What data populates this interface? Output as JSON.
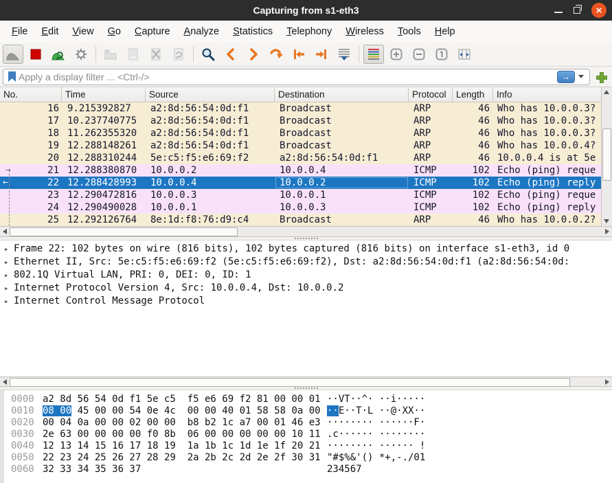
{
  "window": {
    "title": "Capturing from s1-eth3"
  },
  "menu": {
    "items": [
      {
        "label": "File"
      },
      {
        "label": "Edit"
      },
      {
        "label": "View"
      },
      {
        "label": "Go"
      },
      {
        "label": "Capture"
      },
      {
        "label": "Analyze"
      },
      {
        "label": "Statistics"
      },
      {
        "label": "Telephony"
      },
      {
        "label": "Wireless"
      },
      {
        "label": "Tools"
      },
      {
        "label": "Help"
      }
    ]
  },
  "toolbar": {
    "icons": [
      "start-capture",
      "stop-capture",
      "restart-capture",
      "capture-options",
      "open-file",
      "save-file",
      "close-file",
      "reload-file",
      "find-packet",
      "go-back",
      "go-forward",
      "go-to-packet",
      "go-first",
      "go-last",
      "auto-scroll",
      "colorize",
      "zoom-in",
      "zoom-out",
      "zoom-original",
      "resize-columns"
    ]
  },
  "filter": {
    "placeholder": "Apply a display filter ... <Ctrl-/>"
  },
  "colors": {
    "selection": "#1d76c2",
    "arp_row": "#f6edd4",
    "icmp_row": "#f9e2f9",
    "close_button": "#e95420",
    "nav_arrows": "#e87722"
  },
  "packet_list": {
    "columns": [
      "No.",
      "Time",
      "Source",
      "Destination",
      "Protocol",
      "Length",
      "Info"
    ],
    "indicators": {
      "request": "→",
      "response": "←"
    },
    "rows": [
      {
        "no": "16",
        "time": "9.215392827",
        "source": "a2:8d:56:54:0d:f1",
        "destination": "Broadcast",
        "protocol": "ARP",
        "length": "46",
        "info": "Who has 10.0.0.3?"
      },
      {
        "no": "17",
        "time": "10.237740775",
        "source": "a2:8d:56:54:0d:f1",
        "destination": "Broadcast",
        "protocol": "ARP",
        "length": "46",
        "info": "Who has 10.0.0.3?"
      },
      {
        "no": "18",
        "time": "11.262355320",
        "source": "a2:8d:56:54:0d:f1",
        "destination": "Broadcast",
        "protocol": "ARP",
        "length": "46",
        "info": "Who has 10.0.0.3?"
      },
      {
        "no": "19",
        "time": "12.288148261",
        "source": "a2:8d:56:54:0d:f1",
        "destination": "Broadcast",
        "protocol": "ARP",
        "length": "46",
        "info": "Who has 10.0.0.4?"
      },
      {
        "no": "20",
        "time": "12.288310244",
        "source": "5e:c5:f5:e6:69:f2",
        "destination": "a2:8d:56:54:0d:f1",
        "protocol": "ARP",
        "length": "46",
        "info": "10.0.0.4 is at 5e"
      },
      {
        "no": "21",
        "time": "12.288380870",
        "source": "10.0.0.2",
        "destination": "10.0.0.4",
        "protocol": "ICMP",
        "length": "102",
        "info": "Echo (ping) reque"
      },
      {
        "no": "22",
        "time": "12.288428993",
        "source": "10.0.0.4",
        "destination": "10.0.0.2",
        "protocol": "ICMP",
        "length": "102",
        "info": "Echo (ping) reply"
      },
      {
        "no": "23",
        "time": "12.290472816",
        "source": "10.0.0.3",
        "destination": "10.0.0.1",
        "protocol": "ICMP",
        "length": "102",
        "info": "Echo (ping) reque"
      },
      {
        "no": "24",
        "time": "12.290490028",
        "source": "10.0.0.1",
        "destination": "10.0.0.3",
        "protocol": "ICMP",
        "length": "102",
        "info": "Echo (ping) reply"
      },
      {
        "no": "25",
        "time": "12.292126764",
        "source": "8e:1d:f8:76:d9:c4",
        "destination": "Broadcast",
        "protocol": "ARP",
        "length": "46",
        "info": "Who has 10.0.0.2?"
      }
    ]
  },
  "details": {
    "expander_glyph": "▸",
    "lines": [
      "Frame 22: 102 bytes on wire (816 bits), 102 bytes captured (816 bits) on interface s1-eth3, id 0",
      "Ethernet II, Src: 5e:c5:f5:e6:69:f2 (5e:c5:f5:e6:69:f2), Dst: a2:8d:56:54:0d:f1 (a2:8d:56:54:0d:",
      "802.1Q Virtual LAN, PRI: 0, DEI: 0, ID: 1",
      "Internet Protocol Version 4, Src: 10.0.0.4, Dst: 10.0.0.2",
      "Internet Control Message Protocol"
    ]
  },
  "hexdump": {
    "rows": [
      {
        "offset": "0000",
        "hex_pre": "a2 8d 56 54 0d f1 5e c5  f5 e6 69 f2 81 00 00 01",
        "hex_sel": "",
        "hex_post": "",
        "ascii_pre": "··VT··^· ··i·····",
        "ascii_sel": "",
        "ascii_post": ""
      },
      {
        "offset": "0010",
        "hex_pre": "",
        "hex_sel": "08 00",
        "hex_post": " 45 00 00 54 0e 4c  00 00 40 01 58 58 0a 00",
        "ascii_pre": "",
        "ascii_sel": "··",
        "ascii_post": "E··T·L ··@·XX··"
      },
      {
        "offset": "0020",
        "hex_pre": "00 04 0a 00 00 02 00 00  b8 b2 1c a7 00 01 46 e3",
        "hex_sel": "",
        "hex_post": "",
        "ascii_pre": "········ ······F·",
        "ascii_sel": "",
        "ascii_post": ""
      },
      {
        "offset": "0030",
        "hex_pre": "2e 63 00 00 00 00 f0 8b  06 00 00 00 00 00 10 11",
        "hex_sel": "",
        "hex_post": "",
        "ascii_pre": ".c······ ········",
        "ascii_sel": "",
        "ascii_post": ""
      },
      {
        "offset": "0040",
        "hex_pre": "12 13 14 15 16 17 18 19  1a 1b 1c 1d 1e 1f 20 21",
        "hex_sel": "",
        "hex_post": "",
        "ascii_pre": "········ ······ !",
        "ascii_sel": "",
        "ascii_post": ""
      },
      {
        "offset": "0050",
        "hex_pre": "22 23 24 25 26 27 28 29  2a 2b 2c 2d 2e 2f 30 31",
        "hex_sel": "",
        "hex_post": "",
        "ascii_pre": "\"#$%&'() *+,-./01",
        "ascii_sel": "",
        "ascii_post": ""
      },
      {
        "offset": "0060",
        "hex_pre": "32 33 34 35 36 37",
        "hex_sel": "",
        "hex_post": "",
        "ascii_pre": "234567",
        "ascii_sel": "",
        "ascii_post": ""
      }
    ]
  }
}
